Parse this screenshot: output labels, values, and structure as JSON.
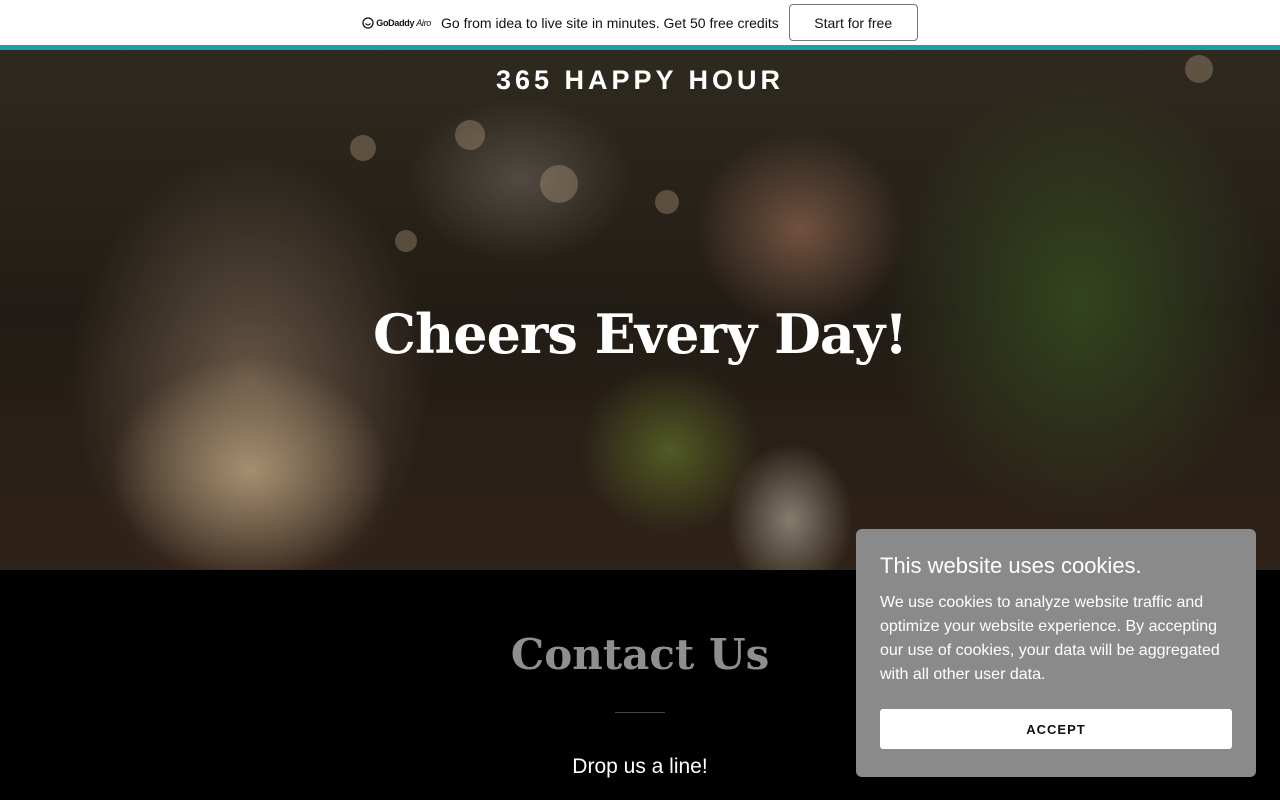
{
  "promo": {
    "logo_brand": "GoDaddy",
    "logo_product": "Airo",
    "text": "Go from idea to live site in minutes. Get 50 free credits",
    "button_label": "Start for free",
    "accent_color": "#1ba0a3"
  },
  "hero": {
    "site_title": "365 HAPPY HOUR",
    "heading": "Cheers Every Day!"
  },
  "contact": {
    "heading": "Contact Us",
    "subheading": "Drop us a line!"
  },
  "cookie_banner": {
    "title": "This website uses cookies.",
    "body": "We use cookies to analyze website traffic and optimize your website experience. By accepting our use of cookies, your data will be aggregated with all other user data.",
    "accept_label": "ACCEPT"
  }
}
